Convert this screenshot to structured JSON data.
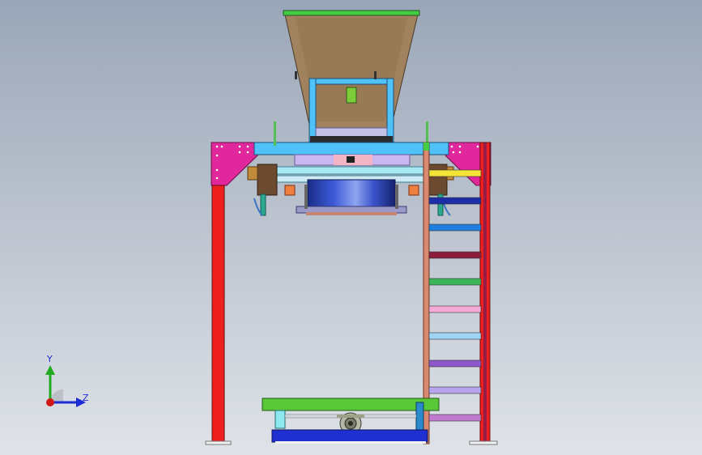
{
  "triad": {
    "y_label": "Y",
    "z_label": "Z",
    "y_color": "#22aa22",
    "z_color": "#1b2bd6",
    "origin_color": "#d01818"
  },
  "model": {
    "hopper_color": "#a0825e",
    "hopper_rim_color": "#44cc44",
    "frame_panel_color": "#e0279b",
    "leg_color": "#ee1f1f",
    "beam_color": "#4fc3f7",
    "drum_color": "#2e47c4",
    "ladder_rail_color": "#d9896f",
    "pallet_top_color": "#59c93a",
    "pallet_base_color": "#1f2fd0",
    "ladder_rungs": [
      "#f3e437",
      "#1d2ea8",
      "#1e7fe0",
      "#8b1c3a",
      "#3cb55a",
      "#f7a9d6",
      "#9fd4f5",
      "#8e58c9",
      "#b9a4ee",
      "#c07ad0"
    ]
  }
}
